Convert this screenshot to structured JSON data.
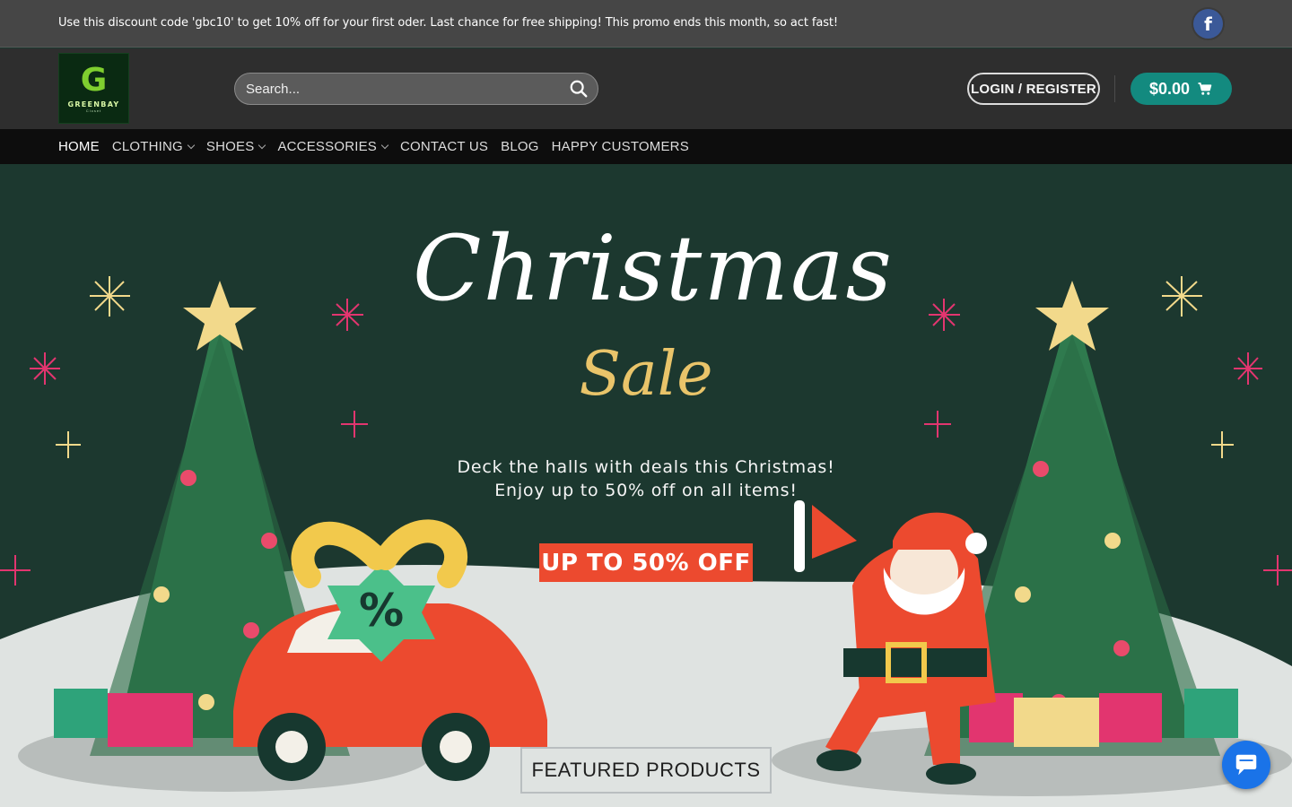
{
  "topbar": {
    "promo": "Use this discount code 'gbc10' to get 10% off for your first oder. Last chance for free shipping! This promo ends this month, so act fast!",
    "facebook_icon": "facebook-icon"
  },
  "header": {
    "logo": {
      "letter": "G",
      "brand": "GREENBAY",
      "sub": "Closet"
    },
    "search": {
      "placeholder": "Search...",
      "value": ""
    },
    "login_label": "LOGIN / REGISTER",
    "cart_total": "$0.00"
  },
  "nav": {
    "items": [
      {
        "label": "HOME",
        "active": true,
        "dropdown": false
      },
      {
        "label": "CLOTHING",
        "active": false,
        "dropdown": true
      },
      {
        "label": "SHOES",
        "active": false,
        "dropdown": true
      },
      {
        "label": "ACCESSORIES",
        "active": false,
        "dropdown": true
      },
      {
        "label": "CONTACT US",
        "active": false,
        "dropdown": false
      },
      {
        "label": "BLOG",
        "active": false,
        "dropdown": false
      },
      {
        "label": "HAPPY CUSTOMERS",
        "active": false,
        "dropdown": false
      }
    ]
  },
  "hero": {
    "title": "Christmas",
    "subtitle": "Sale",
    "line1": "Deck the halls with deals this Christmas!",
    "line2": "Enjoy up to 50% off on all items!",
    "badge": "UP TO 50% OFF"
  },
  "section": {
    "featured_title": "FEATURED PRODUCTS"
  },
  "colors": {
    "topbar_bg": "#464646",
    "header_bg": "#2e2e2e",
    "nav_bg": "#0d0d0d",
    "accent_teal": "#138a7f",
    "hero_bg": "#1c382f",
    "badge_red": "#ec4a2f",
    "gold": "#e9c46a"
  }
}
